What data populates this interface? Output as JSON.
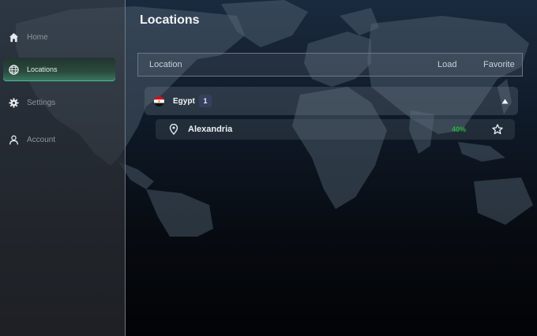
{
  "sidebar": {
    "items": [
      {
        "label": "Home",
        "icon": "home-icon",
        "active": false
      },
      {
        "label": "Locations",
        "icon": "globe-icon",
        "active": true
      },
      {
        "label": "Settings",
        "icon": "gear-icon",
        "active": false
      },
      {
        "label": "Account",
        "icon": "user-icon",
        "active": false
      }
    ]
  },
  "main": {
    "title": "Locations",
    "columns": {
      "location": "Location",
      "load": "Load",
      "favorite": "Favorite"
    },
    "countries": [
      {
        "name": "Egypt",
        "server_count": "1",
        "flag_icon": "egypt-flag-icon",
        "expanded": true,
        "cities": [
          {
            "name": "Alexandria",
            "load": "40%",
            "favorite": false
          }
        ]
      }
    ]
  },
  "colors": {
    "accent": "#3b7a63",
    "load_good": "#27b33a"
  }
}
